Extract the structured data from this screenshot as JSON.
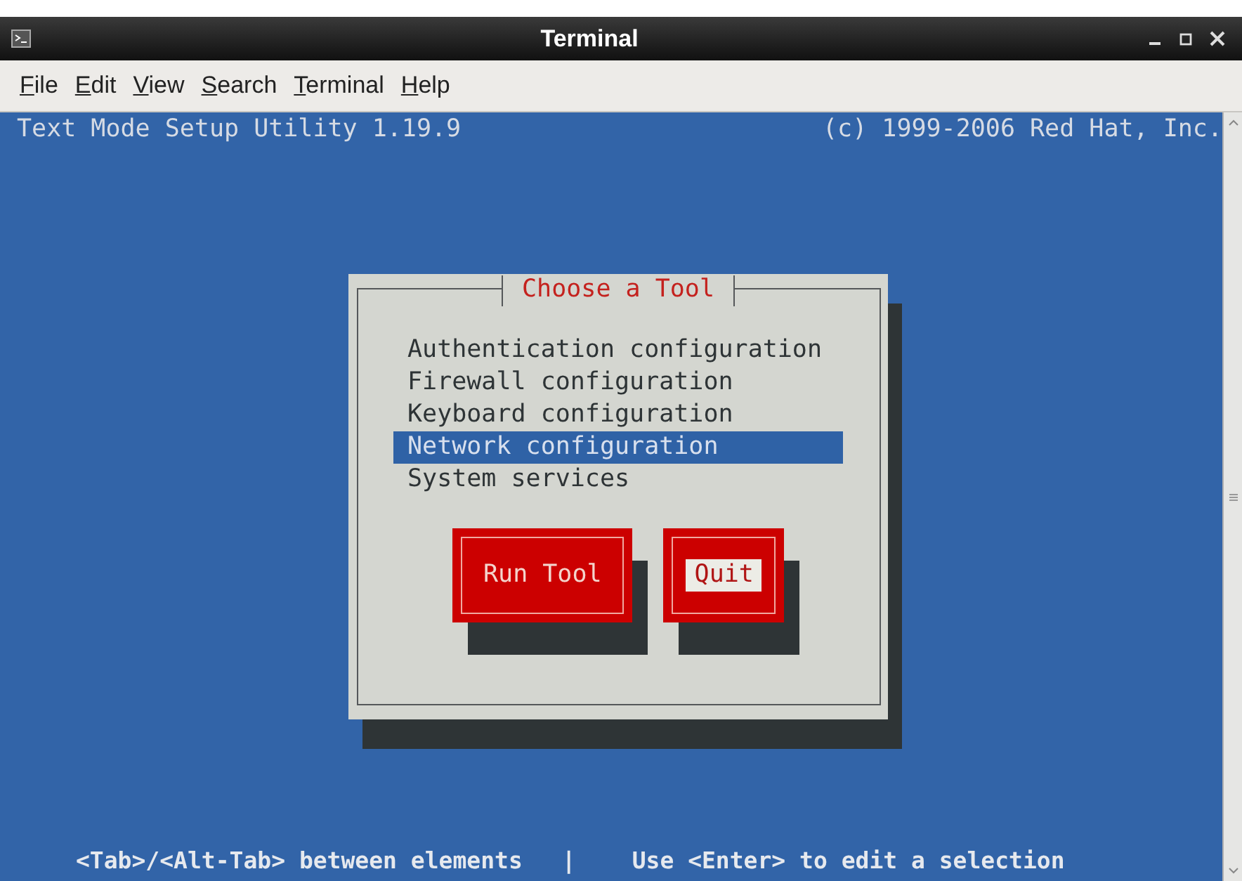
{
  "window": {
    "title": "Terminal"
  },
  "menu": [
    {
      "label": "File"
    },
    {
      "label": "Edit"
    },
    {
      "label": "View"
    },
    {
      "label": "Search"
    },
    {
      "label": "Terminal"
    },
    {
      "label": "Help"
    }
  ],
  "header": {
    "left": "Text Mode Setup Utility 1.19.9",
    "right": "(c) 1999-2006 Red Hat, Inc."
  },
  "dialog": {
    "title": "Choose a Tool",
    "items": [
      {
        "label": "Authentication configuration",
        "selected": false
      },
      {
        "label": "Firewall configuration",
        "selected": false
      },
      {
        "label": "Keyboard configuration",
        "selected": false
      },
      {
        "label": "Network configuration",
        "selected": true
      },
      {
        "label": "System services",
        "selected": false
      }
    ],
    "buttons": [
      {
        "label": "Run Tool",
        "focused": false
      },
      {
        "label": "Quit",
        "focused": true
      }
    ]
  },
  "footer": {
    "left": "<Tab>/<Alt-Tab> between elements",
    "separator": "|",
    "right": "Use <Enter> to edit a selection"
  }
}
